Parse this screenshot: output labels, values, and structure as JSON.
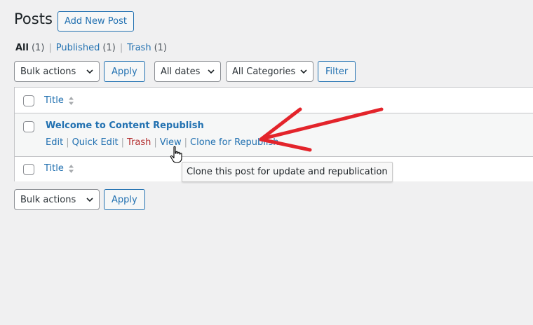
{
  "header": {
    "title": "Posts",
    "add_new_label": "Add New Post"
  },
  "views": [
    {
      "label": "All",
      "count": "(1)",
      "current": true
    },
    {
      "label": "Published",
      "count": "(1)",
      "current": false
    },
    {
      "label": "Trash",
      "count": "(1)",
      "current": false
    }
  ],
  "views_separator": "|",
  "top_nav": {
    "bulk_actions": "Bulk actions",
    "apply_label": "Apply",
    "dates_filter": "All dates",
    "categories_filter": "All Categories",
    "filter_label": "Filter"
  },
  "table": {
    "column_title": "Title",
    "post": {
      "title": "Welcome to Content Republish",
      "row_actions": {
        "edit": "Edit",
        "quick_edit": "Quick Edit",
        "trash": "Trash",
        "view": "View",
        "clone": "Clone for Republish"
      }
    }
  },
  "bottom_nav": {
    "bulk_actions": "Bulk actions",
    "apply_label": "Apply"
  },
  "tooltip": "Clone this post for update and republication",
  "icons": {
    "select_chevron": "chevron-down-icon",
    "sort": "sort-icon",
    "annotation": "red-arrow-icon",
    "pointer": "hand-pointer-icon"
  },
  "colors": {
    "link": "#2271b1",
    "trash": "#b32d2e",
    "background": "#f0f0f1",
    "annotation_arrow": "#e3242b"
  }
}
